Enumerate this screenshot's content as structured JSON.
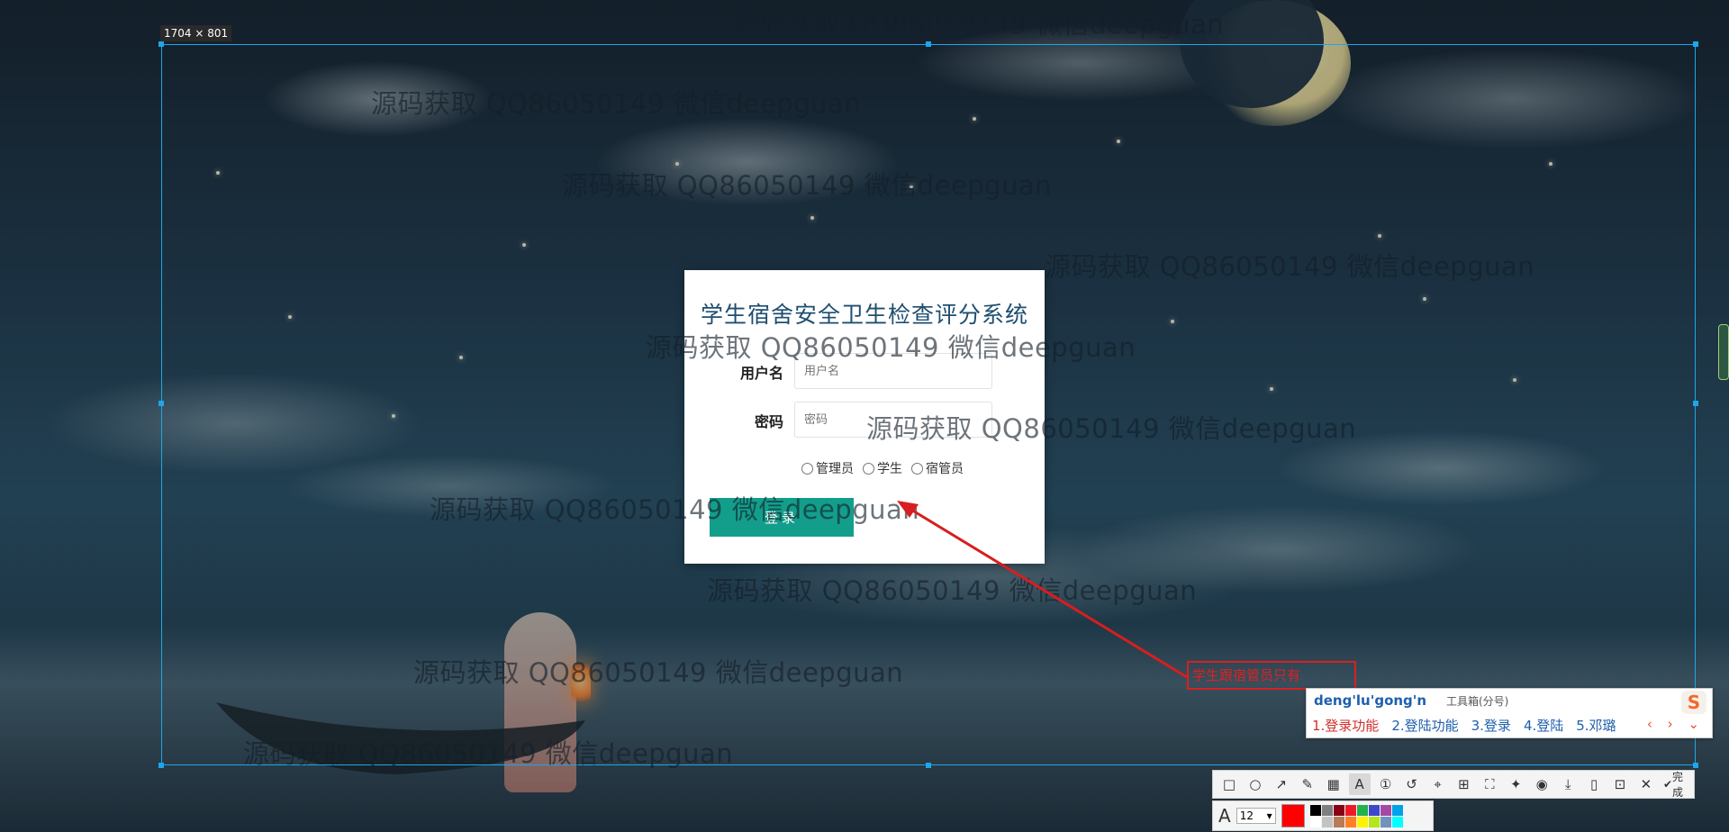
{
  "selection": {
    "size_label": "1704 × 801"
  },
  "login": {
    "title": "学生宿舍安全卫生检查评分系统",
    "username_label": "用户名",
    "username_placeholder": "用户名",
    "password_label": "密码",
    "password_placeholder": "密码",
    "roles": [
      "管理员",
      "学生",
      "宿管员"
    ],
    "login_button": "登录"
  },
  "watermark_text": "源码获取 QQ86050149 微信deepguan",
  "watermarks": [
    "源码获取 QQ86050149 微信deepguan",
    "源码获取 QQ86050149 微信deepguan",
    "源码获取 QQ86050149 微信deepguan",
    "源码获取 QQ86050149 微信deepguan",
    "源码获取 QQ86050149 微信deepguan",
    "源码获取 QQ86050149 微信deepguan",
    "源码获取 QQ86050149 微信deepguan",
    "源码获取 QQ86050149 微信deepguan",
    "源码获取 QQ86050149 微信deepguan",
    "源码获取 QQ86050149 微信deepguan"
  ],
  "annotation": {
    "text": "学生跟宿管员只有",
    "color": "#e02020"
  },
  "ime": {
    "pinyin": "deng'lu'gong'n",
    "toolbox_hint": "工具箱(分号)",
    "logo": "S",
    "candidates": [
      "1.登录功能",
      "2.登陆功能",
      "3.登录",
      "4.登陆",
      "5.邓璐"
    ],
    "nav": "‹ › ⌄"
  },
  "toolbar": {
    "tools": [
      "rectangle-icon",
      "ellipse-icon",
      "arrow-icon",
      "pen-icon",
      "mosaic-icon",
      "text-icon",
      "number-icon",
      "undo-icon",
      "pin-icon",
      "ocr-icon",
      "long-screenshot-icon",
      "sticky-icon",
      "record-icon",
      "download-icon",
      "phone-icon",
      "save-icon",
      "close-icon"
    ],
    "done_label": "完成",
    "font_size": "12",
    "current_color": "#ff0000",
    "palette": [
      "#000000",
      "#7f7f7f",
      "#880015",
      "#ed1c24",
      "#22b14c",
      "#3f48cc",
      "#a349a4",
      "#00a2e8",
      "#ffffff",
      "#c3c3c3",
      "#b97a57",
      "#ff7f27",
      "#fff200",
      "#b5e61d",
      "#7092be",
      "#00ffff"
    ]
  }
}
